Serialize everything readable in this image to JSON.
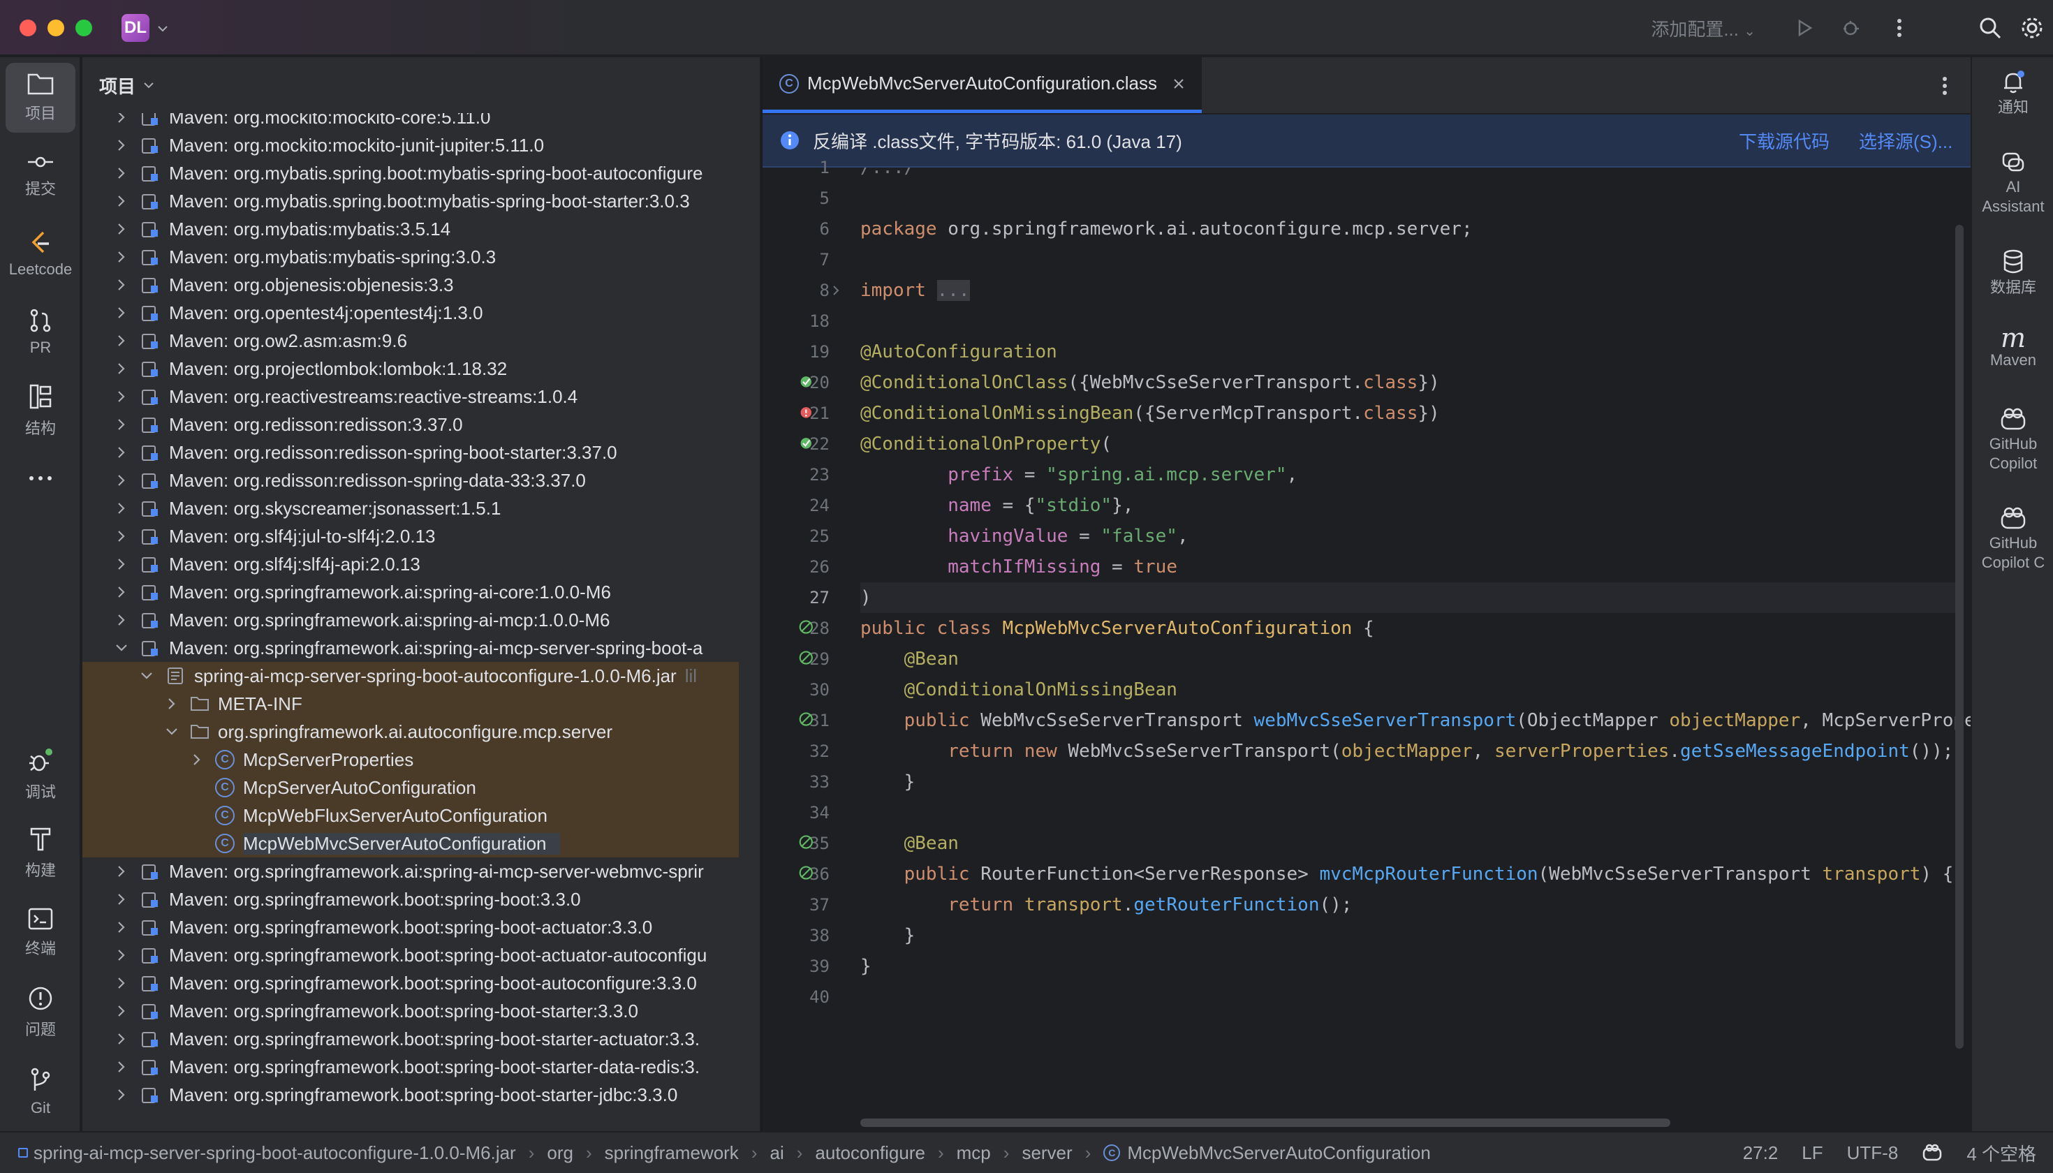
{
  "window": {
    "project_badge": "DL"
  },
  "toolbar": {
    "run_config": "添加配置..."
  },
  "left_tools": [
    {
      "label": "项目",
      "icon": "folder-icon"
    },
    {
      "label": "提交",
      "icon": "commit-icon"
    },
    {
      "label": "Leetcode",
      "icon": "leetcode-icon"
    },
    {
      "label": "PR",
      "icon": "pull-request-icon"
    },
    {
      "label": "结构",
      "icon": "structure-icon"
    },
    {
      "label": "调试",
      "icon": "debug-icon"
    },
    {
      "label": "构建",
      "icon": "build-icon"
    },
    {
      "label": "终端",
      "icon": "terminal-icon"
    },
    {
      "label": "问题",
      "icon": "problems-icon"
    },
    {
      "label": "Git",
      "icon": "git-icon"
    }
  ],
  "project_panel": {
    "title": "项目",
    "tree": [
      {
        "text": "Maven: org.mockito:mockito-core:5.11.0",
        "level": 0,
        "type": "lib"
      },
      {
        "text": "Maven: org.mockito:mockito-junit-jupiter:5.11.0",
        "level": 0,
        "type": "lib"
      },
      {
        "text": "Maven: org.mybatis.spring.boot:mybatis-spring-boot-autoconfigure",
        "level": 0,
        "type": "lib"
      },
      {
        "text": "Maven: org.mybatis.spring.boot:mybatis-spring-boot-starter:3.0.3",
        "level": 0,
        "type": "lib"
      },
      {
        "text": "Maven: org.mybatis:mybatis:3.5.14",
        "level": 0,
        "type": "lib"
      },
      {
        "text": "Maven: org.mybatis:mybatis-spring:3.0.3",
        "level": 0,
        "type": "lib"
      },
      {
        "text": "Maven: org.objenesis:objenesis:3.3",
        "level": 0,
        "type": "lib"
      },
      {
        "text": "Maven: org.opentest4j:opentest4j:1.3.0",
        "level": 0,
        "type": "lib"
      },
      {
        "text": "Maven: org.ow2.asm:asm:9.6",
        "level": 0,
        "type": "lib"
      },
      {
        "text": "Maven: org.projectlombok:lombok:1.18.32",
        "level": 0,
        "type": "lib"
      },
      {
        "text": "Maven: org.reactivestreams:reactive-streams:1.0.4",
        "level": 0,
        "type": "lib"
      },
      {
        "text": "Maven: org.redisson:redisson:3.37.0",
        "level": 0,
        "type": "lib"
      },
      {
        "text": "Maven: org.redisson:redisson-spring-boot-starter:3.37.0",
        "level": 0,
        "type": "lib"
      },
      {
        "text": "Maven: org.redisson:redisson-spring-data-33:3.37.0",
        "level": 0,
        "type": "lib"
      },
      {
        "text": "Maven: org.skyscreamer:jsonassert:1.5.1",
        "level": 0,
        "type": "lib"
      },
      {
        "text": "Maven: org.slf4j:jul-to-slf4j:2.0.13",
        "level": 0,
        "type": "lib"
      },
      {
        "text": "Maven: org.slf4j:slf4j-api:2.0.13",
        "level": 0,
        "type": "lib"
      },
      {
        "text": "Maven: org.springframework.ai:spring-ai-core:1.0.0-M6",
        "level": 0,
        "type": "lib"
      },
      {
        "text": "Maven: org.springframework.ai:spring-ai-mcp:1.0.0-M6",
        "level": 0,
        "type": "lib"
      },
      {
        "text": "Maven: org.springframework.ai:spring-ai-mcp-server-spring-boot-a",
        "level": 0,
        "type": "lib",
        "expanded": true
      },
      {
        "text": "spring-ai-mcp-server-spring-boot-autoconfigure-1.0.0-M6.jar",
        "suffix": "lil",
        "level": 1,
        "type": "jar",
        "expanded": true,
        "hl": true
      },
      {
        "text": "META-INF",
        "level": 2,
        "type": "folder",
        "hl": true
      },
      {
        "text": "org.springframework.ai.autoconfigure.mcp.server",
        "level": 2,
        "type": "folder",
        "expanded": true,
        "hl": true
      },
      {
        "text": "McpServerProperties",
        "level": 3,
        "type": "class",
        "hl": true,
        "chev": true
      },
      {
        "text": "McpServerAutoConfiguration",
        "level": 3,
        "type": "class",
        "hl": true
      },
      {
        "text": "McpWebFluxServerAutoConfiguration",
        "level": 3,
        "type": "class",
        "hl": true
      },
      {
        "text": "McpWebMvcServerAutoConfiguration",
        "level": 3,
        "type": "class",
        "hl": true,
        "selected": true
      },
      {
        "text": "Maven: org.springframework.ai:spring-ai-mcp-server-webmvc-sprir",
        "level": 0,
        "type": "lib"
      },
      {
        "text": "Maven: org.springframework.boot:spring-boot:3.3.0",
        "level": 0,
        "type": "lib"
      },
      {
        "text": "Maven: org.springframework.boot:spring-boot-actuator:3.3.0",
        "level": 0,
        "type": "lib"
      },
      {
        "text": "Maven: org.springframework.boot:spring-boot-actuator-autoconfigu",
        "level": 0,
        "type": "lib"
      },
      {
        "text": "Maven: org.springframework.boot:spring-boot-autoconfigure:3.3.0",
        "level": 0,
        "type": "lib"
      },
      {
        "text": "Maven: org.springframework.boot:spring-boot-starter:3.3.0",
        "level": 0,
        "type": "lib"
      },
      {
        "text": "Maven: org.springframework.boot:spring-boot-starter-actuator:3.3.",
        "level": 0,
        "type": "lib"
      },
      {
        "text": "Maven: org.springframework.boot:spring-boot-starter-data-redis:3.",
        "level": 0,
        "type": "lib"
      },
      {
        "text": "Maven: org.springframework.boot:spring-boot-starter-jdbc:3.3.0",
        "level": 0,
        "type": "lib"
      }
    ]
  },
  "editor": {
    "tab_label": "McpWebMvcServerAutoConfiguration.class",
    "info_text": "反编译 .class文件, 字节码版本: 61.0 (Java 17)",
    "download_link": "下载源代码",
    "choose_link": "选择源(S)...",
    "line_numbers": [
      "1",
      "5",
      "6",
      "7",
      "8",
      "18",
      "19",
      "20",
      "21",
      "22",
      "23",
      "24",
      "25",
      "26",
      "27",
      "28",
      "29",
      "30",
      "31",
      "32",
      "33",
      "34",
      "35",
      "36",
      "37",
      "38",
      "39",
      "40"
    ],
    "current_line": "27"
  },
  "right_tools": [
    {
      "label": "通知",
      "icon": "bell-icon"
    },
    {
      "label": "AI\nAssistant",
      "icon": "ai-assistant-icon"
    },
    {
      "label": "数据库",
      "icon": "database-icon"
    },
    {
      "label": "Maven",
      "icon": "maven-icon"
    },
    {
      "label": "GitHub\nCopilot",
      "icon": "copilot-icon"
    },
    {
      "label": "GitHub\nCopilot C",
      "icon": "copilot-chat-icon"
    }
  ],
  "statusbar": {
    "breadcrumbs": [
      "spring-ai-mcp-server-spring-boot-autoconfigure-1.0.0-M6.jar",
      "org",
      "springframework",
      "ai",
      "autoconfigure",
      "mcp",
      "server",
      "McpWebMvcServerAutoConfiguration"
    ],
    "position": "27:2",
    "line_sep": "LF",
    "encoding": "UTF-8",
    "indent": "4 个空格"
  },
  "colors": {
    "accent": "#3574f0",
    "info_bg": "#25324d",
    "link": "#548af7"
  }
}
